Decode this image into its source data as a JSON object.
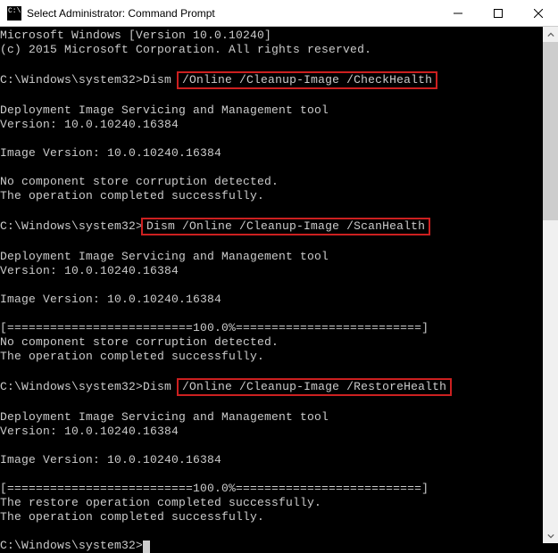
{
  "titlebar": {
    "title": "Select Administrator: Command Prompt"
  },
  "terminal": {
    "header1": "Microsoft Windows [Version 10.0.10240]",
    "header2": "(c) 2015 Microsoft Corporation. All rights reserved.",
    "prompt": "C:\\Windows\\system32>",
    "cmd1_pre": "Dism ",
    "cmd1_hl": "/Online /Cleanup-Image /CheckHealth",
    "tool_line": "Deployment Image Servicing and Management tool",
    "version_line": "Version: 10.0.10240.16384",
    "image_version": "Image Version: 10.0.10240.16384",
    "no_corrupt": "No component store corruption detected.",
    "op_success": "The operation completed successfully.",
    "cmd2_hl": "Dism /Online /Cleanup-Image /ScanHealth",
    "progress": "[==========================100.0%==========================]",
    "cmd3_pre": "Dism ",
    "cmd3_hl": "/Online /Cleanup-Image /RestoreHealth",
    "restore_success": "The restore operation completed successfully."
  }
}
